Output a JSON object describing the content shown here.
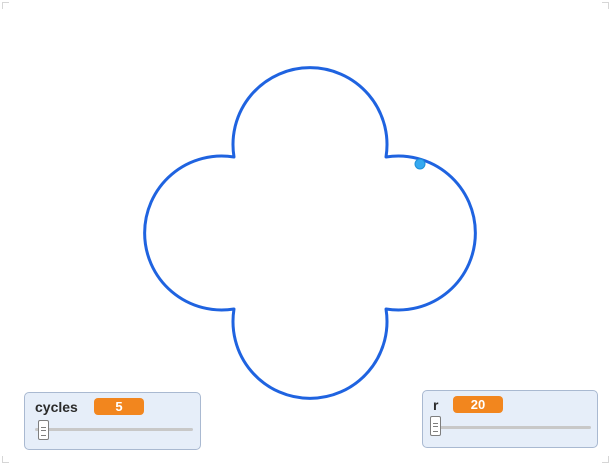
{
  "stage": {
    "background_color": "#ffffff",
    "curve_color": "#1f63e0",
    "sprite_color": "#35a9f0",
    "shape": "four-lobed curve (epicycloid)"
  },
  "monitors": [
    {
      "label": "cycles",
      "value": "5",
      "slider_fraction": 0.03
    },
    {
      "label": "r",
      "value": "20",
      "slider_fraction": 0.0
    }
  ],
  "colors": {
    "monitor_background": "#e6eef9",
    "monitor_border": "#a9b9d1",
    "value_badge": "#f2861e"
  }
}
